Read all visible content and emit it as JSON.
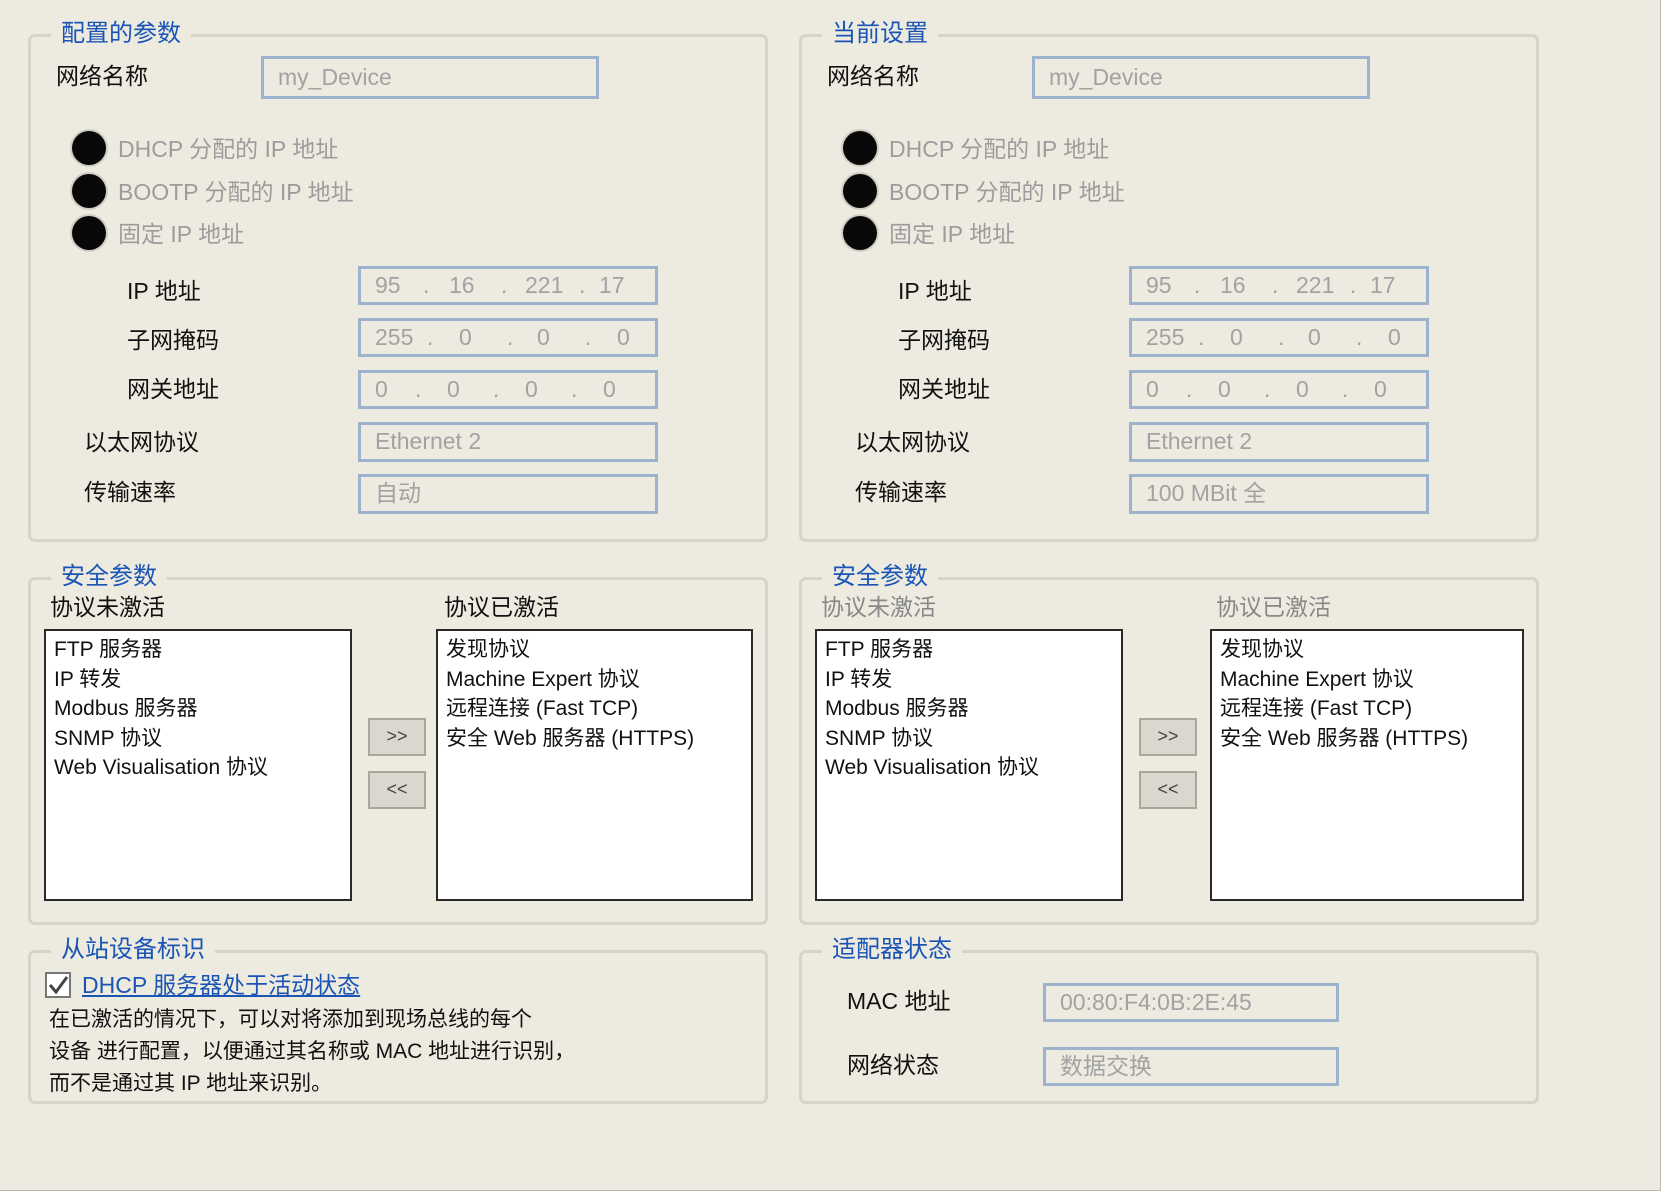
{
  "configured": {
    "title": "配置的参数",
    "network_name_label": "网络名称",
    "network_name_value": "my_Device",
    "modes": [
      {
        "label": "DHCP 分配的 IP 地址"
      },
      {
        "label": "BOOTP 分配的 IP 地址"
      },
      {
        "label": "固定 IP 地址"
      }
    ],
    "ip_label": "IP 地址",
    "ip": [
      "95",
      "16",
      "221",
      "17"
    ],
    "subnet_label": "子网掩码",
    "subnet": [
      "255",
      "0",
      "0",
      "0"
    ],
    "gateway_label": "网关地址",
    "gateway": [
      "0",
      "0",
      "0",
      "0"
    ],
    "ethernet_label": "以太网协议",
    "ethernet_value": "Ethernet 2",
    "speed_label": "传输速率",
    "speed_value": "自动"
  },
  "current": {
    "title": "当前设置",
    "network_name_label": "网络名称",
    "network_name_value": "my_Device",
    "modes": [
      {
        "label": "DHCP 分配的 IP 地址"
      },
      {
        "label": "BOOTP 分配的 IP 地址"
      },
      {
        "label": "固定 IP 地址"
      }
    ],
    "ip_label": "IP 地址",
    "ip": [
      "95",
      "16",
      "221",
      "17"
    ],
    "subnet_label": "子网掩码",
    "subnet": [
      "255",
      "0",
      "0",
      "0"
    ],
    "gateway_label": "网关地址",
    "gateway": [
      "0",
      "0",
      "0",
      "0"
    ],
    "ethernet_label": "以太网协议",
    "ethernet_value": "Ethernet 2",
    "speed_label": "传输速率",
    "speed_value": "100 MBit 全"
  },
  "security_left": {
    "title": "安全参数",
    "inactive_label": "协议未激活",
    "active_label": "协议已激活",
    "inactive_items": [
      "FTP 服务器",
      "IP 转发",
      "Modbus 服务器",
      "SNMP 协议",
      "Web Visualisation 协议"
    ],
    "active_items": [
      "发现协议",
      "Machine Expert 协议",
      "远程连接 (Fast TCP)",
      "安全 Web 服务器 (HTTPS)"
    ],
    "add_label": ">>",
    "remove_label": "<<"
  },
  "security_right": {
    "title": "安全参数",
    "inactive_label": "协议未激活",
    "active_label": "协议已激活",
    "inactive_items": [
      "FTP 服务器",
      "IP 转发",
      "Modbus 服务器",
      "SNMP 协议",
      "Web Visualisation 协议"
    ],
    "active_items": [
      "发现协议",
      "Machine Expert 协议",
      "远程连接 (Fast TCP)",
      "安全 Web 服务器 (HTTPS)"
    ],
    "add_label": ">>",
    "remove_label": "<<"
  },
  "slave": {
    "title": "从站设备标识",
    "checkbox_label": "DHCP 服务器处于活动状态",
    "checked": true,
    "description": [
      "在已激活的情况下，可以对将添加到现场总线的每个",
      "设备 进行配置，以便通过其名称或 MAC 地址进行识别，",
      "而不是通过其 IP 地址来识别。"
    ]
  },
  "adapter": {
    "title": "适配器状态",
    "mac_label": "MAC 地址",
    "mac_value": "00:80:F4:0B:2E:45",
    "net_status_label": "网络状态",
    "net_status_value": "数据交换"
  }
}
